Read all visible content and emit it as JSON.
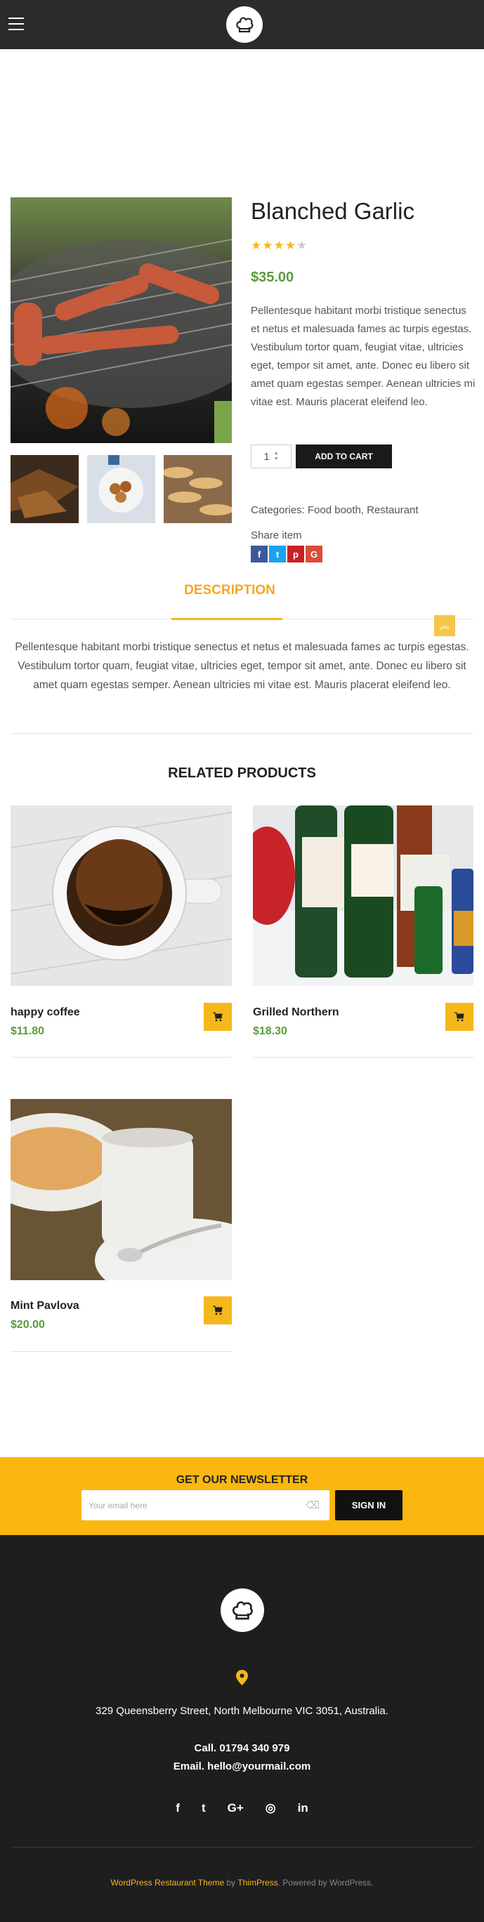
{
  "header": {
    "menu_icon": "hamburger-icon",
    "logo_icon": "chef-hat-icon"
  },
  "product": {
    "title": "Blanched Garlic",
    "rating": 4,
    "rating_max": 5,
    "price": "$35.00",
    "description": "Pellentesque habitant morbi tristique senectus et netus et malesuada fames ac turpis egestas. Vestibulum tortor quam, feugiat vitae, ultricies eget, tempor sit amet, ante. Donec eu libero sit amet quam egestas semper. Aenean ultricies mi vitae est. Mauris placerat eleifend leo.",
    "quantity": "1",
    "add_to_cart": "ADD TO CART",
    "categories_label": "Categories:",
    "categories": "Food booth, Restaurant",
    "share_label": "Share item",
    "share_icons": [
      "f",
      "t",
      "p",
      "G"
    ]
  },
  "tabs": {
    "active": "DESCRIPTION",
    "description_text": "Pellentesque habitant morbi tristique senectus et netus et malesuada fames ac turpis egestas. Vestibulum tortor quam, feugiat vitae, ultricies eget, tempor sit amet, ante. Donec eu libero sit amet quam egestas semper. Aenean ultricies mi vitae est. Mauris placerat eleifend leo."
  },
  "related": {
    "title": "RELATED PRODUCTS",
    "items": [
      {
        "name": "happy coffee",
        "price": "$11.80"
      },
      {
        "name": "Grilled Northern",
        "price": "$18.30"
      },
      {
        "name": "Mint Pavlova",
        "price": "$20.00"
      }
    ]
  },
  "newsletter": {
    "title": "GET OUR NEWSLETTER",
    "placeholder": "Your email here",
    "button": "SIGN IN"
  },
  "footer": {
    "address": "329 Queensberry Street, North Melbourne VIC 3051, Australia.",
    "call": "Call. 01794 340 979",
    "email": "Email. hello@yourmail.com",
    "socials": [
      "f",
      "t",
      "G+",
      "◎",
      "in"
    ],
    "credit_link": "WordPress Restaurant Theme",
    "credit_by": " by ",
    "credit_author": "ThimPress",
    "credit_tail": ". Powered by WordPress."
  },
  "colors": {
    "accent": "#fbb710",
    "price_green": "#5b9b3b",
    "dark": "#2b2b2b"
  }
}
